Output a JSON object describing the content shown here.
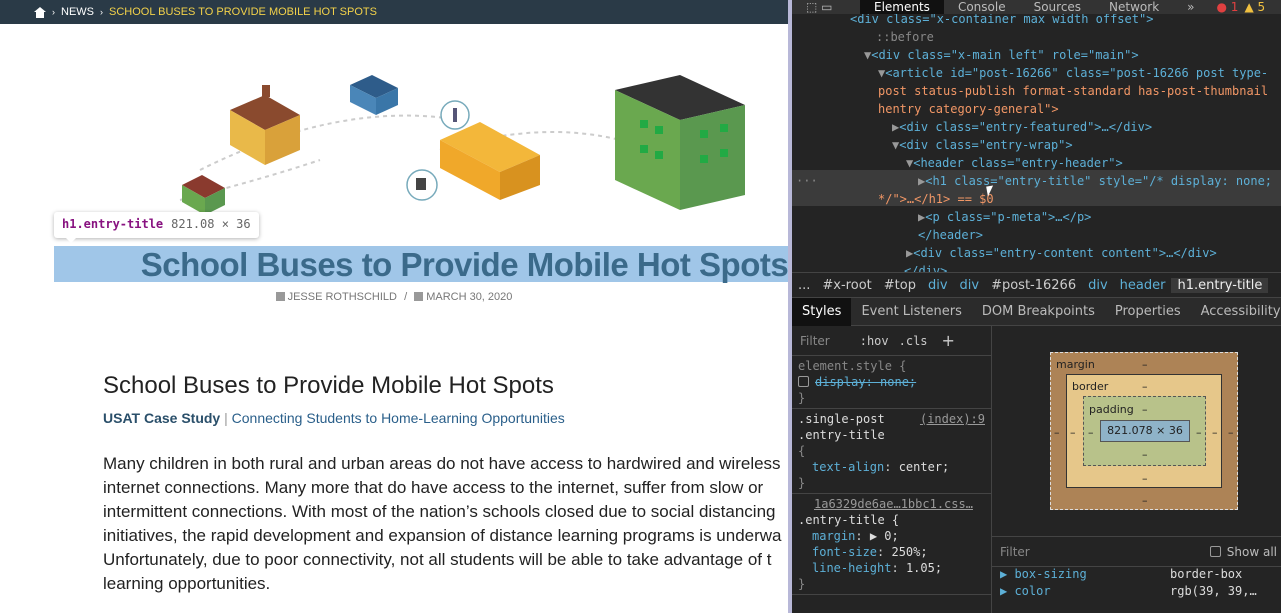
{
  "breadcrumb": {
    "news": "NEWS",
    "current": "SCHOOL BUSES TO PROVIDE MOBILE HOT SPOTS"
  },
  "tooltip": {
    "tag": "h1.entry-title",
    "size": "821.08 × 36"
  },
  "article": {
    "title": "School Buses to Provide Mobile Hot Spots",
    "author": "JESSE ROTHSCHILD",
    "date": "MARCH 30, 2020",
    "heading": "School Buses to Provide Mobile Hot Spots",
    "case_study": "USAT Case Study",
    "subtitle": "Connecting Students to Home-Learning Opportunities",
    "body_lines": [
      "Many children in both rural and urban areas do not have access to hardwired and wireless",
      "internet connections. Many more that do have access to the internet, suffer from slow or",
      "intermittent connections. With most of the nation’s schools closed due to social distancing",
      "initiatives, the rapid development and expansion of distance learning programs is underwa",
      "Unfortunately, due to poor connectivity, not all students will be able to take advantage of t",
      "learning opportunities."
    ]
  },
  "devtools": {
    "tabs": [
      "Elements",
      "Console",
      "Sources",
      "Network"
    ],
    "more": "»",
    "errors": "1",
    "warnings": "5",
    "tree": [
      "<div class=\"x-container max width offset\">",
      "::before",
      "<div class=\"x-main left\" role=\"main\">",
      "<article id=\"post-16266\" class=\"post-16266 post type-",
      "post status-publish format-standard has-post-thumbnail",
      "hentry category-general\">",
      "<div class=\"entry-featured\">…</div>",
      "<div class=\"entry-wrap\">",
      "<header class=\"entry-header\">",
      "<h1 class=\"entry-title\" style=\"/* display: none;",
      "*/\">…</h1> == $0",
      "<p class=\"p-meta\">…</p>",
      "</header>",
      "<div class=\"entry-content content\">…</div>",
      "</div>"
    ],
    "crumbs": [
      "...",
      "#x-root",
      "#top",
      "div",
      "div",
      "#post-16266",
      "div",
      "header",
      "h1.entry-title"
    ],
    "subtabs": [
      "Styles",
      "Event Listeners",
      "DOM Breakpoints",
      "Properties",
      "Accessibility"
    ],
    "filter": "Filter",
    "hov": ":hov",
    "cls": ".cls",
    "plus": "+",
    "rules": {
      "r1_selector": "element.style {",
      "r1_prop": "display: none;",
      "r1_close": "}",
      "r2_selector": ".single-post",
      "r2_selector2": ".entry-title",
      "r2_src": "(index):9",
      "r2_open": "{",
      "r2_prop": "text-align",
      "r2_val": "center;",
      "r2_close": "}",
      "r3_src": "1a6329de6ae…1bbc1.css…",
      "r3_selector": ".entry-title {",
      "r3_p1": "margin",
      "r3_v1": "▶ 0;",
      "r3_p2": "font-size",
      "r3_v2": "250%;",
      "r3_p3": "line-height",
      "r3_v3": "1.05;",
      "r3_close": "}"
    },
    "boxmodel": {
      "margin": "margin",
      "border": "border",
      "padding": "padding",
      "dash": "–",
      "content": "821.078 × 36"
    },
    "computed": {
      "filter": "Filter",
      "show_all": "Show all",
      "rows": [
        {
          "k": "box-sizing",
          "v": "border-box"
        },
        {
          "k": "color",
          "v": "rgb(39, 39,…"
        }
      ]
    }
  }
}
